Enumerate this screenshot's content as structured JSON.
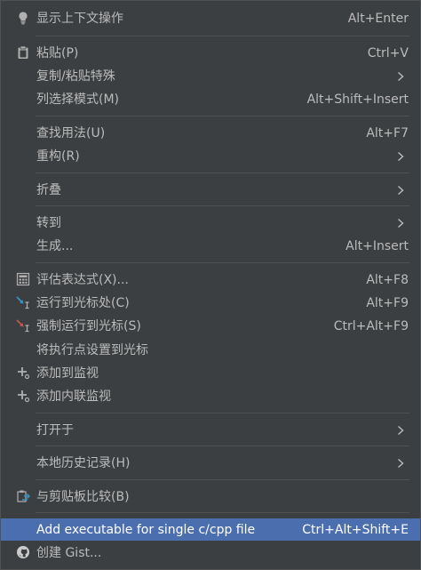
{
  "menu": {
    "items": [
      {
        "label": "显示上下文操作",
        "shortcut": "Alt+Enter"
      },
      {
        "label": "粘贴(P)",
        "shortcut": "Ctrl+V"
      },
      {
        "label": "复制/粘贴特殊",
        "shortcut": ""
      },
      {
        "label": "列选择模式(M)",
        "shortcut": "Alt+Shift+Insert"
      },
      {
        "label": "查找用法(U)",
        "shortcut": "Alt+F7"
      },
      {
        "label": "重构(R)",
        "shortcut": ""
      },
      {
        "label": "折叠",
        "shortcut": ""
      },
      {
        "label": "转到",
        "shortcut": ""
      },
      {
        "label": "生成...",
        "shortcut": "Alt+Insert"
      },
      {
        "label": "评估表达式(X)...",
        "shortcut": "Alt+F8"
      },
      {
        "label": "运行到光标处(C)",
        "shortcut": "Alt+F9"
      },
      {
        "label": "强制运行到光标(S)",
        "shortcut": "Ctrl+Alt+F9"
      },
      {
        "label": "将执行点设置到光标",
        "shortcut": ""
      },
      {
        "label": "添加到监视",
        "shortcut": ""
      },
      {
        "label": "添加内联监视",
        "shortcut": ""
      },
      {
        "label": "打开于",
        "shortcut": ""
      },
      {
        "label": "本地历史记录(H)",
        "shortcut": ""
      },
      {
        "label": "与剪贴板比较(B)",
        "shortcut": ""
      },
      {
        "label": "Add executable for single c/cpp file",
        "shortcut": "Ctrl+Alt+Shift+E"
      },
      {
        "label": "创建 Gist...",
        "shortcut": ""
      }
    ],
    "icons": {
      "bulb": "lightbulb-icon",
      "paste": "clipboard-icon",
      "evaluate": "calculator-icon",
      "run_to_cursor": "run-to-cursor-icon",
      "force_run_to_cursor": "force-run-to-cursor-icon",
      "add_watch": "add-watch-icon",
      "compare": "compare-clipboard-icon",
      "github": "github-icon",
      "submenu": "chevron-right-icon"
    },
    "colors": {
      "background": "#3c3f41",
      "selected": "#4b6eaf",
      "text": "#bbbbbb",
      "separator": "#515151"
    }
  }
}
